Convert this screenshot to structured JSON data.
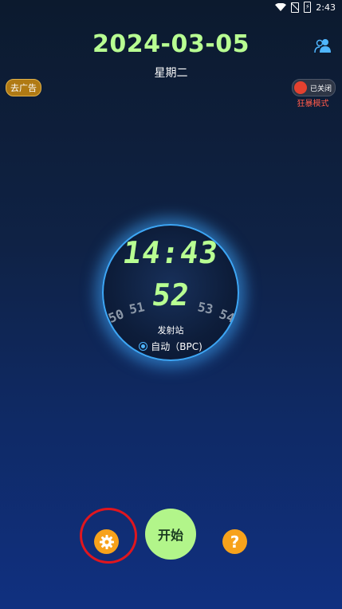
{
  "status_bar": {
    "time": "2:43"
  },
  "header": {
    "date": "2024-03-05",
    "weekday": "星期二"
  },
  "ad_button": {
    "label": "去广告"
  },
  "mode_toggle": {
    "state_label": "已关闭",
    "mode_label": "狂暴模式"
  },
  "clock": {
    "time": "14:43",
    "second": "52",
    "neighbor_seconds": [
      "50",
      "51",
      "53",
      "54"
    ],
    "station_title": "发射站",
    "station_value": "自动（BPC)"
  },
  "bottom": {
    "start_label": "开始",
    "help_label": "?"
  },
  "colors": {
    "accent_green": "#b8ff92",
    "orange": "#f7a21b",
    "highlight_red": "#e0161e"
  },
  "icons": [
    "wifi-icon",
    "sim-icon",
    "battery-icon",
    "users-icon",
    "gear-icon",
    "question-icon"
  ]
}
